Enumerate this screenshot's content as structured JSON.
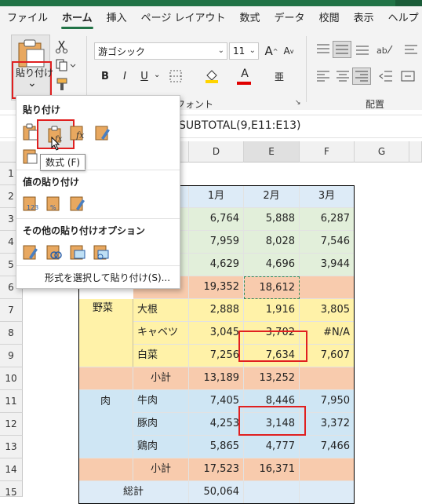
{
  "tabs": [
    "ファイル",
    "ホーム",
    "挿入",
    "ページ レイアウト",
    "数式",
    "データ",
    "校閲",
    "表示",
    "ヘルプ"
  ],
  "ribbon": {
    "paste_label": "貼り付け",
    "paste_caret": "⌄",
    "font_name": "游ゴシック",
    "font_size": "11",
    "font_group_label": "フォント",
    "align_group_label": "配置",
    "bold": "B",
    "italic": "I",
    "underline": "U",
    "grow": "A",
    "shrink": "A",
    "fontcolor": "A",
    "phonetic": "亜"
  },
  "formula": {
    "text": "SUBTOTAL(9,E11:E13)"
  },
  "paste_panel": {
    "section1": "貼り付け",
    "section2": "値の貼り付け",
    "section3": "その他の貼り付けオプション",
    "special": "形式を選択して貼り付け(S)...",
    "tooltip": "数式 (F)"
  },
  "columns": [
    "D",
    "E",
    "F",
    "G"
  ],
  "rows": [
    "1",
    "2",
    "3",
    "4",
    "5",
    "6",
    "7",
    "8",
    "9",
    "10",
    "11",
    "12",
    "13",
    "14",
    "15"
  ],
  "sheet": {
    "r2": {
      "d": "1月",
      "e": "2月",
      "f": "3月"
    },
    "r3": {
      "d": "6,764",
      "e": "5,888",
      "f": "6,287"
    },
    "r4": {
      "d": "7,959",
      "e": "8,028",
      "f": "7,546"
    },
    "r5": {
      "d": "4,629",
      "e": "4,696",
      "f": "3,944"
    },
    "r6": {
      "d": "19,352",
      "e": "18,612"
    },
    "r7": {
      "a": "野菜",
      "b": "大根",
      "d": "2,888",
      "e": "1,916",
      "f": "3,805"
    },
    "r8": {
      "b": "キャベツ",
      "d": "3,045",
      "e": "3,702",
      "f": "#N/A"
    },
    "r9": {
      "b": "白菜",
      "d": "7,256",
      "e": "7,634",
      "f": "7,607"
    },
    "r10": {
      "b": "小計",
      "d": "13,189",
      "e": "13,252"
    },
    "r11": {
      "a": "肉",
      "b": "牛肉",
      "d": "7,405",
      "e": "8,446",
      "f": "7,950"
    },
    "r12": {
      "b": "豚肉",
      "d": "4,253",
      "e": "3,148",
      "f": "3,372"
    },
    "r13": {
      "b": "鶏肉",
      "d": "5,865",
      "e": "4,777",
      "f": "7,466"
    },
    "r14": {
      "b": "小計",
      "d": "17,523",
      "e": "16,371"
    },
    "r15": {
      "a": "総計",
      "d": "50,064"
    }
  }
}
